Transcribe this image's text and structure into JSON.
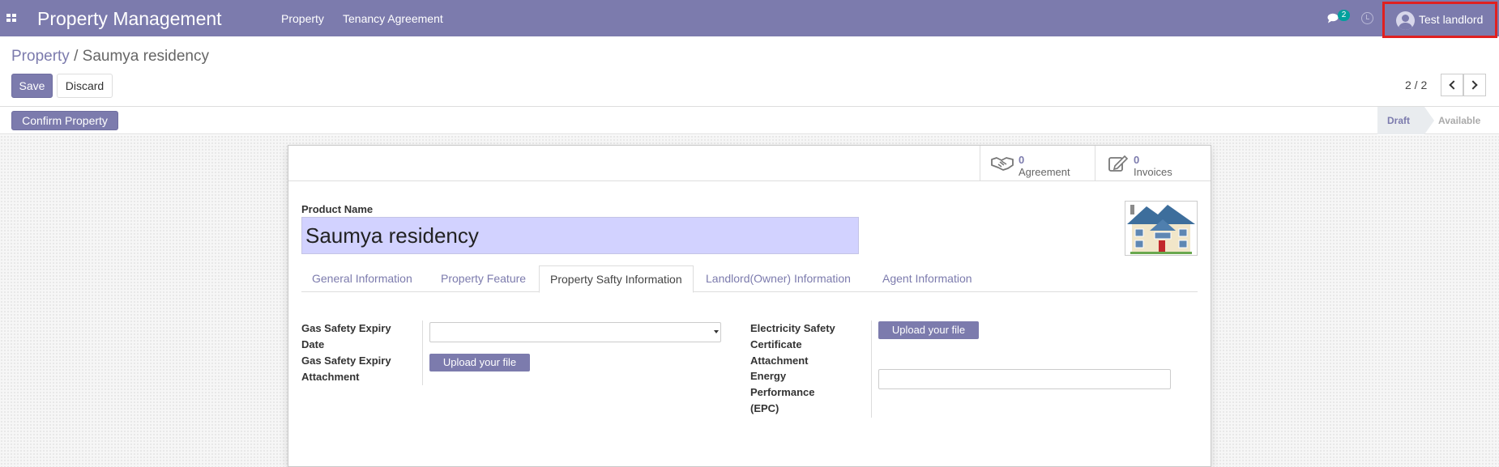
{
  "navbar": {
    "app_title": "Property Management",
    "menu": [
      "Property",
      "Tenancy Agreement"
    ],
    "chat_count": "2",
    "user_name": "Test landlord",
    "color": "#7c7bad"
  },
  "breadcrumb": {
    "parent": "Property",
    "separator": " / ",
    "current": "Saumya residency"
  },
  "actions": {
    "save": "Save",
    "discard": "Discard",
    "confirm": "Confirm Property"
  },
  "pager": {
    "value": "2 / 2"
  },
  "statusbar": {
    "stages": [
      "Draft",
      "Available"
    ],
    "active": "Draft"
  },
  "smart_buttons": [
    {
      "icon": "handshake-icon",
      "value": "0",
      "label": "Agreement"
    },
    {
      "icon": "edit-icon",
      "value": "0",
      "label": "Invoices"
    }
  ],
  "form": {
    "name_label": "Product Name",
    "name_value": "Saumya residency",
    "tabs": [
      "General Information",
      "Property Feature",
      "Property Safty Information",
      "Landlord(Owner) Information",
      "Agent Information"
    ],
    "active_tab": "Property Safty Information",
    "left_fields": {
      "gas_expiry_date_label_1": "Gas Safety Expiry",
      "gas_expiry_date_label_2": "Date",
      "gas_expiry_date_value": "",
      "gas_attachment_label_1": "Gas Safety Expiry",
      "gas_attachment_label_2": "Attachment",
      "upload_label": "Upload your file"
    },
    "right_fields": {
      "electricity_label_1": "Electricity Safety",
      "electricity_label_2": "Certificate",
      "electricity_label_3": "Attachment",
      "upload_label": "Upload your file",
      "epc_label_1": "Energy",
      "epc_label_2": "Performance",
      "epc_label_3": "(EPC)",
      "epc_value": ""
    }
  }
}
